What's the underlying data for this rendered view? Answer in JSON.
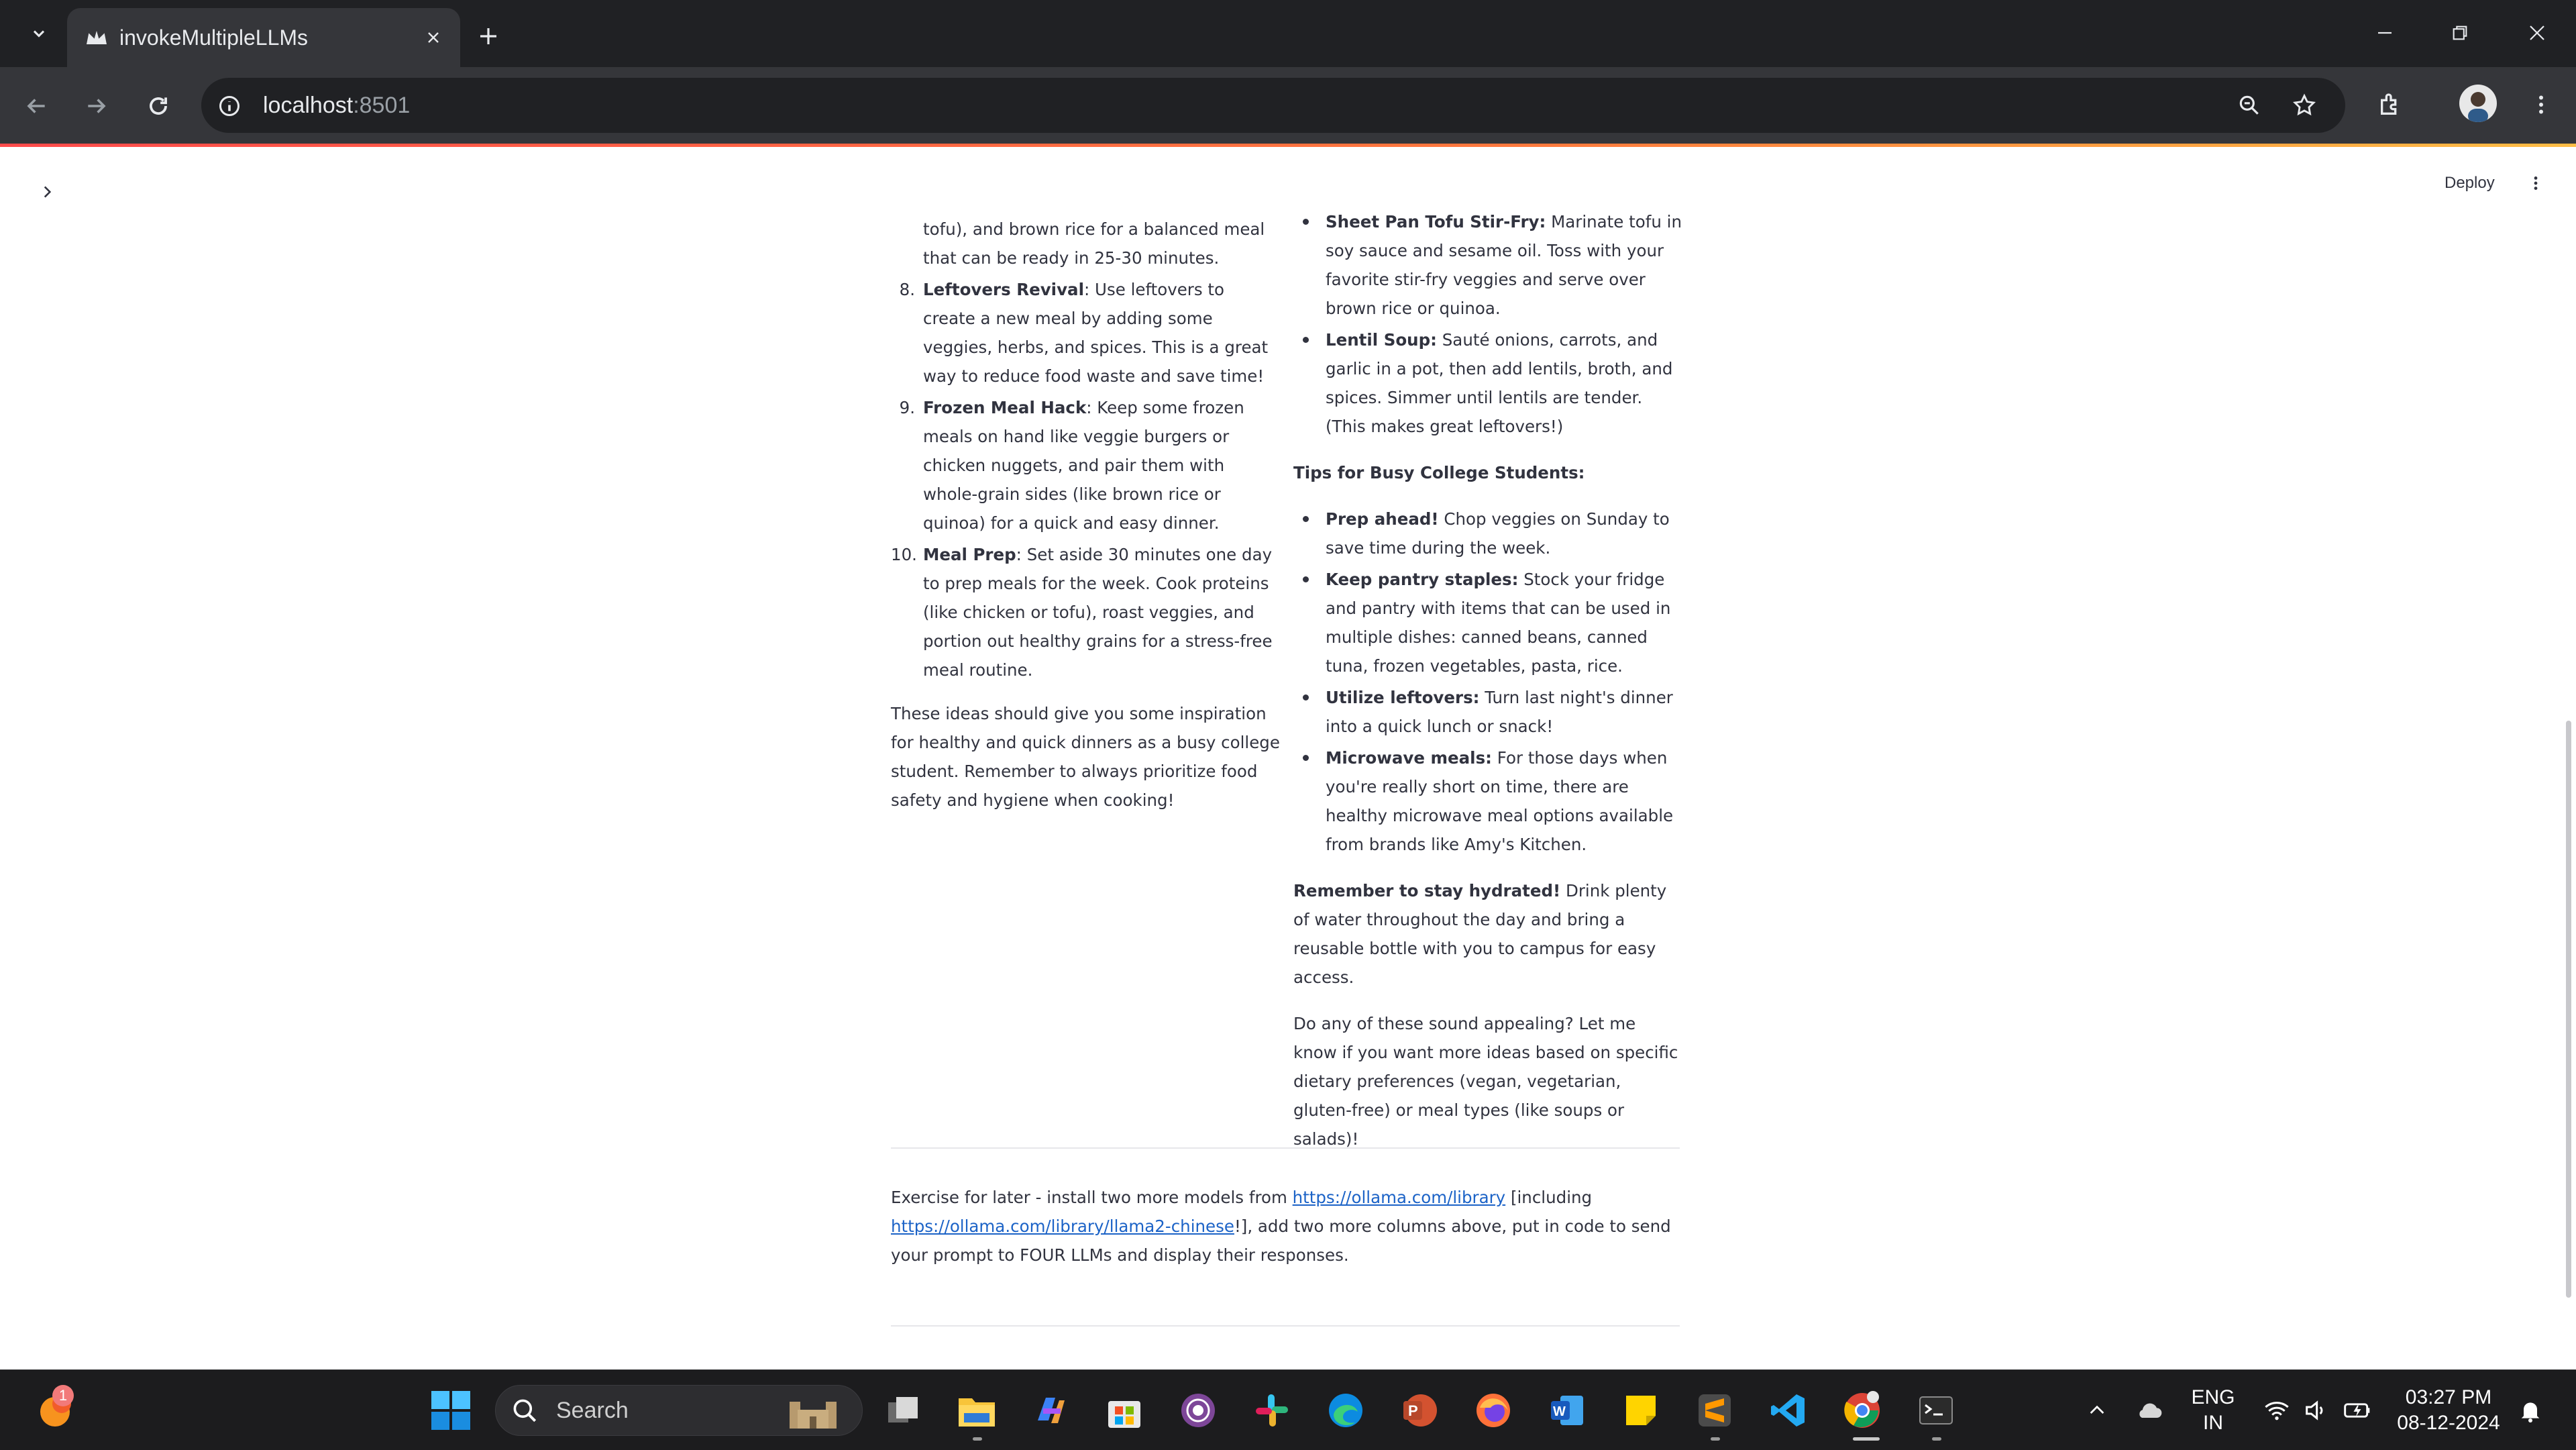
{
  "browser": {
    "tab_title": "invokeMultipleLLMs",
    "url_host": "localhost",
    "url_port": ":8501"
  },
  "app": {
    "deploy_label": "Deploy"
  },
  "left_column": {
    "carryover": "tofu), and brown rice for a balanced meal that can be ready in 25-30 minutes.",
    "items": [
      {
        "num": "8.",
        "title": "Leftovers Revival",
        "text": ": Use leftovers to create a new meal by adding some veggies, herbs, and spices. This is a great way to reduce food waste and save time!"
      },
      {
        "num": "9.",
        "title": "Frozen Meal Hack",
        "text": ": Keep some frozen meals on hand like veggie burgers or chicken nuggets, and pair them with whole-grain sides (like brown rice or quinoa) for a quick and easy dinner."
      },
      {
        "num": "10.",
        "title": "Meal Prep",
        "text": ": Set aside 30 minutes one day to prep meals for the week. Cook proteins (like chicken or tofu), roast veggies, and portion out healthy grains for a stress-free meal routine."
      }
    ],
    "closing": "These ideas should give you some inspiration for healthy and quick dinners as a busy college student. Remember to always prioritize food safety and hygiene when cooking!"
  },
  "right_column": {
    "recipes": [
      {
        "title": "Sheet Pan Tofu Stir-Fry:",
        "text": " Marinate tofu in soy sauce and sesame oil. Toss with your favorite stir-fry veggies and serve over brown rice or quinoa."
      },
      {
        "title": "Lentil Soup:",
        "text": " Sauté onions, carrots, and garlic in a pot, then add lentils, broth, and spices. Simmer until lentils are tender. (This makes great leftovers!)"
      }
    ],
    "tips_heading": "Tips for Busy College Students:",
    "tips": [
      {
        "title": "Prep ahead!",
        "text": " Chop veggies on Sunday to save time during the week."
      },
      {
        "title": "Keep pantry staples:",
        "text": " Stock your fridge and pantry with items that can be used in multiple dishes: canned beans, canned tuna, frozen vegetables, pasta, rice."
      },
      {
        "title": "Utilize leftovers:",
        "text": " Turn last night's dinner into a quick lunch or snack!"
      },
      {
        "title": "Microwave meals:",
        "text": " For those days when you're really short on time, there are healthy microwave meal options available from brands like Amy's Kitchen."
      }
    ],
    "hydrate_title": "Remember to stay hydrated!",
    "hydrate_text": " Drink plenty of water throughout the day and bring a reusable bottle with you to campus for easy access.",
    "closing": "Do any of these sound appealing? Let me know if you want more ideas based on specific dietary preferences (vegan, vegetarian, gluten-free) or meal types (like soups or salads)!"
  },
  "footer": {
    "text_before": "Exercise for later - install two more models from ",
    "link1": "https://ollama.com/library",
    "text_middle": " [including ",
    "link2": "https://ollama.com/library/llama2-chinese",
    "text_after": "!], add two more columns above, put in code to send your prompt to FOUR LLMs and display their responses."
  },
  "taskbar": {
    "search_label": "Search",
    "notification_count": "1",
    "lang_line1": "ENG",
    "lang_line2": "IN",
    "time": "03:27 PM",
    "date": "08-12-2024"
  }
}
